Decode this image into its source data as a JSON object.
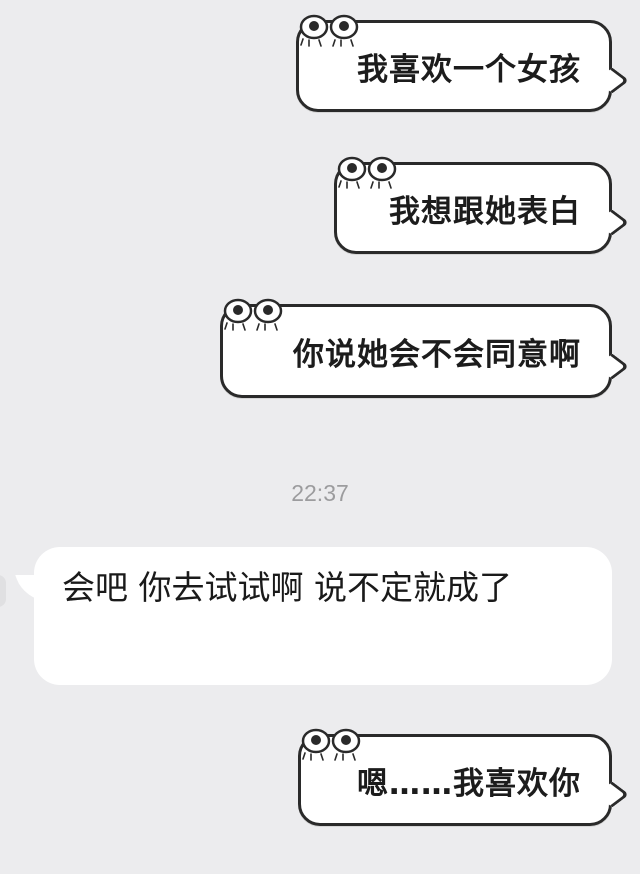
{
  "messages": [
    {
      "side": "sent",
      "style": "comic",
      "text": "我喜欢一个女孩"
    },
    {
      "side": "sent",
      "style": "comic",
      "text": "我想跟她表白"
    },
    {
      "side": "sent",
      "style": "comic",
      "text": "你说她会不会同意啊"
    },
    {
      "side": "received",
      "style": "plain",
      "text": "会吧  你去试试啊  说不定就成了"
    },
    {
      "side": "sent",
      "style": "comic",
      "text": "嗯……我喜欢你"
    }
  ],
  "timestamp": "22:37",
  "colors": {
    "background": "#ececee",
    "bubble": "#ffffff",
    "outline": "#2a2a2a",
    "timestamp": "#9c9c9e"
  },
  "icons": {
    "bubble_decoration": "googly-eyes-icon"
  }
}
